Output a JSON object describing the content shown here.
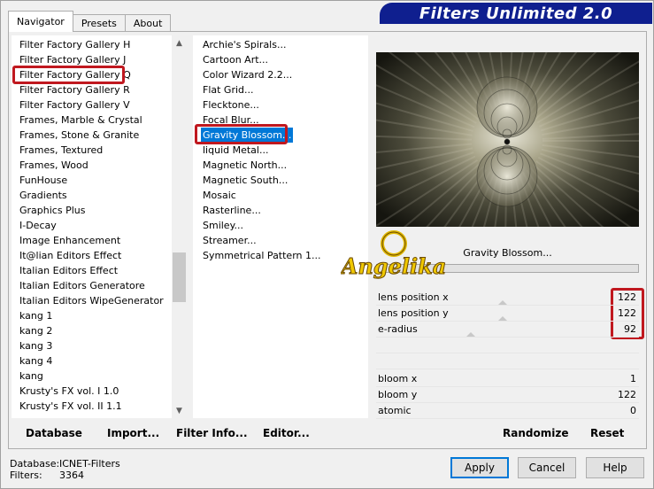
{
  "header": {
    "title": "Filters Unlimited 2.0",
    "tabs": [
      "Navigator",
      "Presets",
      "About"
    ]
  },
  "categories": [
    "Filter Factory Gallery H",
    "Filter Factory Gallery J",
    "Filter Factory Gallery Q",
    "Filter Factory Gallery R",
    "Filter Factory Gallery V",
    "Frames, Marble & Crystal",
    "Frames, Stone & Granite",
    "Frames, Textured",
    "Frames, Wood",
    "FunHouse",
    "Gradients",
    "Graphics Plus",
    "I-Decay",
    "Image Enhancement",
    "It@lian Editors Effect",
    "Italian Editors Effect",
    "Italian Editors Generatore",
    "Italian Editors WipeGenerator",
    "kang 1",
    "kang 2",
    "kang 3",
    "kang 4",
    "kang",
    "Krusty's FX vol. I 1.0",
    "Krusty's FX vol. II 1.1"
  ],
  "filters": [
    "Archie's Spirals...",
    "Cartoon Art...",
    "Color Wizard 2.2...",
    "Flat Grid...",
    "Flecktone...",
    "Focal Blur...",
    "Gravity Blossom...",
    "liquid Metal...",
    "Magnetic North...",
    "Magnetic South...",
    "Mosaic",
    "Rasterline...",
    "Smiley...",
    "Streamer...",
    "Symmetrical Pattern 1..."
  ],
  "selected_filter": "Gravity Blossom...",
  "params": [
    {
      "label": "lens position x",
      "value": "122",
      "slider": 0.48
    },
    {
      "label": "lens position y",
      "value": "122",
      "slider": 0.48
    },
    {
      "label": "e-radius",
      "value": "92",
      "slider": 0.36
    },
    {
      "label": "",
      "value": "",
      "slider": null
    },
    {
      "label": "",
      "value": "",
      "slider": null
    },
    {
      "label": "bloom x",
      "value": "1",
      "slider": null
    },
    {
      "label": "bloom y",
      "value": "122",
      "slider": null
    },
    {
      "label": "atomic",
      "value": "0",
      "slider": null
    }
  ],
  "watermark_text": "Angelika",
  "actions": {
    "database": "Database",
    "import": "Import...",
    "filter_info": "Filter Info...",
    "editor": "Editor...",
    "randomize": "Randomize",
    "reset": "Reset"
  },
  "status": {
    "database_label": "Database:",
    "database_value": "ICNET-Filters",
    "filters_label": "Filters:",
    "filters_value": "3364"
  },
  "buttons": {
    "apply": "Apply",
    "cancel": "Cancel",
    "help": "Help"
  },
  "colors": {
    "banner": "#0f1f8f",
    "highlight_outline": "#c0181f",
    "selection": "#0078d7"
  }
}
